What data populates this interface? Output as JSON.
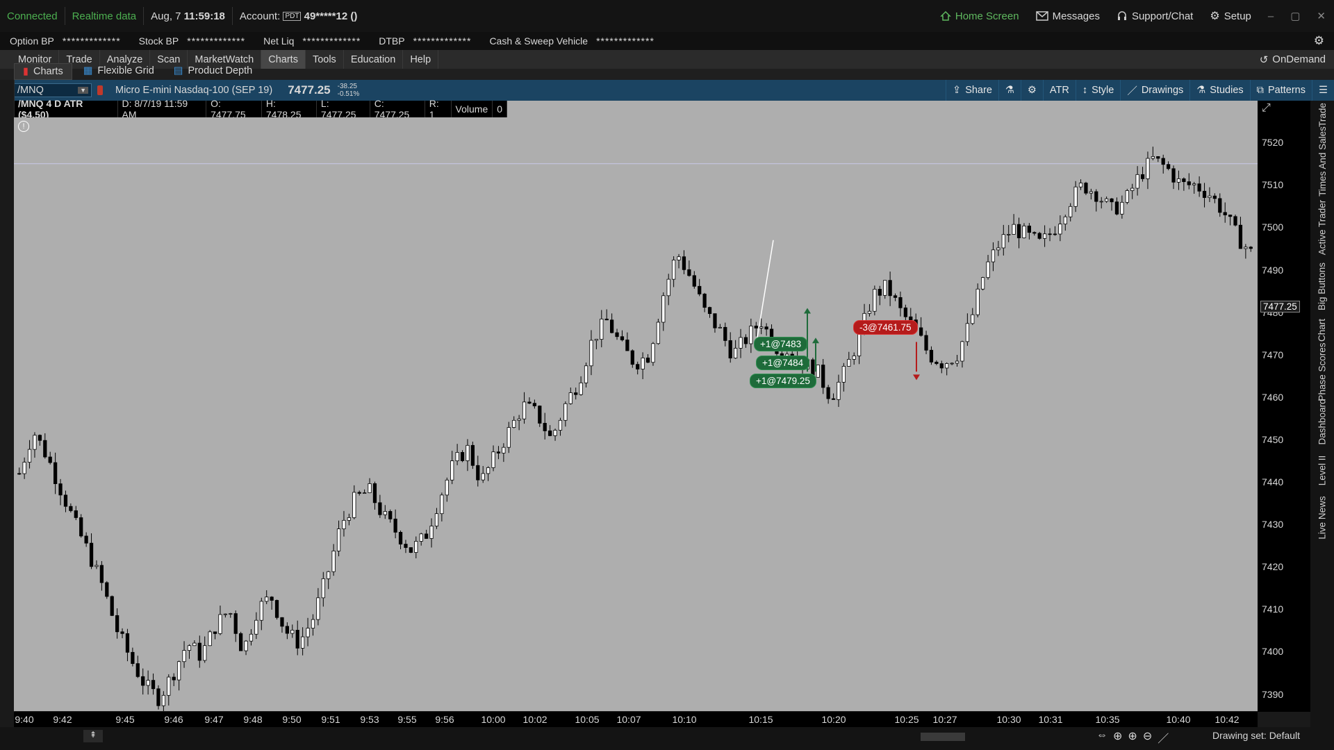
{
  "status": {
    "connected": "Connected",
    "realtime": "Realtime data",
    "date": "Aug, 7",
    "time": "11:59:18",
    "account_label": "Account:",
    "account_badge": "PDT",
    "account_number": "49*****12 ()",
    "home": "Home Screen",
    "messages": "Messages",
    "support": "Support/Chat",
    "setup": "Setup"
  },
  "bp": {
    "option_bp_label": "Option BP",
    "option_bp_value": "*************",
    "stock_bp_label": "Stock BP",
    "stock_bp_value": "*************",
    "net_liq_label": "Net Liq",
    "net_liq_value": "*************",
    "dtbp_label": "DTBP",
    "dtbp_value": "*************",
    "cash_label": "Cash & Sweep Vehicle",
    "cash_value": "*************"
  },
  "menu": [
    "Monitor",
    "Trade",
    "Analyze",
    "Scan",
    "MarketWatch",
    "Charts",
    "Tools",
    "Education",
    "Help"
  ],
  "menu_active": "Charts",
  "ondemand": "OnDemand",
  "subtabs": [
    "Charts",
    "Flexible Grid",
    "Product Depth"
  ],
  "symbol": {
    "ticker": "/MNQ",
    "description": "Micro E-mini Nasdaq-100 (SEP 19)",
    "last": "7477.25",
    "change": "-38.25",
    "change_pct": "-0.51%"
  },
  "tools": [
    "Share",
    "ATR",
    "Style",
    "Drawings",
    "Studies",
    "Patterns"
  ],
  "info": {
    "study": "/MNQ 4 D ATR ($4.50)",
    "date": "D: 8/7/19 11:59 AM",
    "open": "O: 7477.75",
    "high": "H: 7478.25",
    "low": "L: 7477.25",
    "close": "C: 7477.25",
    "r": "R: 1",
    "volume_label": "Volume",
    "volume": "0"
  },
  "price_marker": "7477.25",
  "sidebar_tabs": [
    "Trade",
    "Times And Sales",
    "Active Trader",
    "Big Buttons",
    "Chart",
    "Phase Scores",
    "Dashboard",
    "Level II",
    "Live News"
  ],
  "bottom": {
    "drawing_set": "Drawing set: Default"
  },
  "chart_data": {
    "type": "candlestick",
    "y_ticks": [
      7520,
      7510,
      7500,
      7490,
      7480,
      7470,
      7460,
      7450,
      7440,
      7430,
      7420,
      7410,
      7400,
      7390
    ],
    "ylim": [
      7386,
      7522
    ],
    "x_ticks": [
      "9:40",
      "9:42",
      "9:45",
      "9:46",
      "9:47",
      "9:48",
      "9:50",
      "9:51",
      "9:53",
      "9:55",
      "9:56",
      "10:00",
      "10:02",
      "10:05",
      "10:07",
      "10:10",
      "10:15",
      "10:20",
      "10:25",
      "10:27",
      "10:30",
      "10:31",
      "10:35",
      "10:40",
      "10:42"
    ],
    "price_path": [
      7442,
      7452,
      7446,
      7438,
      7430,
      7423,
      7415,
      7405,
      7398,
      7392,
      7389,
      7395,
      7402,
      7399,
      7406,
      7410,
      7400,
      7410,
      7413,
      7405,
      7402,
      7408,
      7418,
      7430,
      7436,
      7438,
      7432,
      7428,
      7424,
      7427,
      7436,
      7444,
      7448,
      7440,
      7446,
      7452,
      7458,
      7456,
      7450,
      7458,
      7464,
      7474,
      7478,
      7472,
      7468,
      7470,
      7484,
      7494,
      7488,
      7480,
      7476,
      7470,
      7474,
      7478,
      7472,
      7471,
      7468,
      7466,
      7460,
      7466,
      7474,
      7484,
      7486,
      7480,
      7476,
      7470,
      7468,
      7470,
      7478,
      7490,
      7496,
      7500,
      7498,
      7496,
      7500,
      7506,
      7510,
      7508,
      7504,
      7506,
      7512,
      7516,
      7514,
      7510,
      7510,
      7508,
      7504,
      7498,
      7494
    ],
    "trades": [
      {
        "label": "+1@7483",
        "side": "buy"
      },
      {
        "label": "+1@7484",
        "side": "buy"
      },
      {
        "label": "+1@7479.25",
        "side": "buy"
      },
      {
        "label": "-3@7461.75",
        "side": "sell"
      }
    ],
    "colors": {
      "up": "#ffffff",
      "down": "#000000",
      "background": "#aeaeae",
      "buy": "#1e6b3a",
      "sell": "#b51b1b"
    }
  }
}
